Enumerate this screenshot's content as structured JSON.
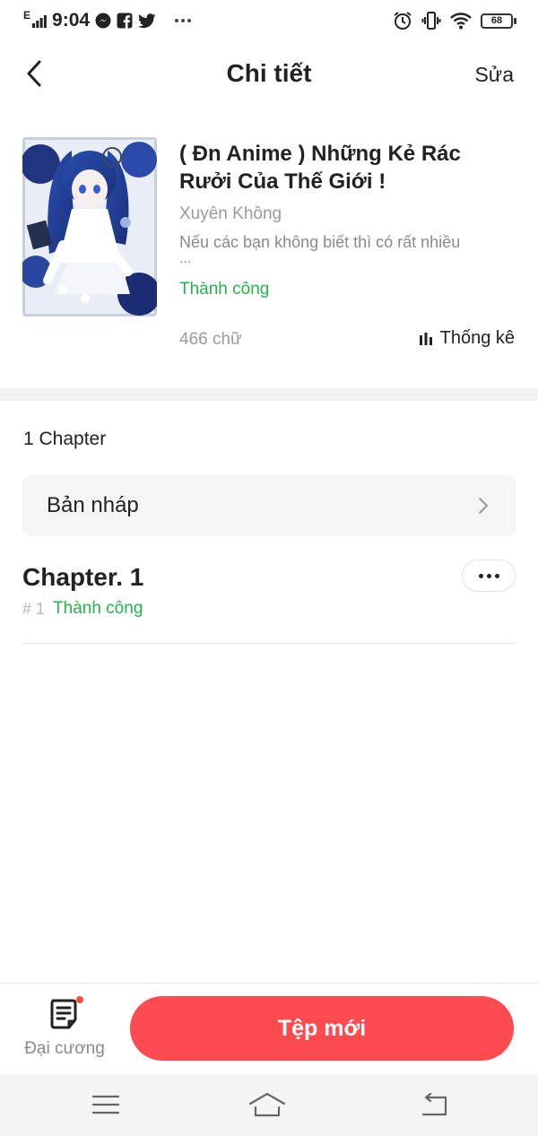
{
  "status_bar": {
    "network": "E",
    "time": "9:04",
    "battery_level": "68",
    "left_icons": [
      "signal-icon",
      "messenger-icon",
      "facebook-icon",
      "twitter-icon",
      "more-dots-icon"
    ],
    "right_icons": [
      "alarm-icon",
      "vibrate-icon",
      "wifi-icon",
      "battery-icon"
    ]
  },
  "header": {
    "title": "Chi tiết",
    "edit_label": "Sửa",
    "back_icon": "back-chevron-icon"
  },
  "story": {
    "title": "( Đn Anime ) Những Kẻ Rác Rưởi Của Thế Giới !",
    "genre": "Xuyên Không",
    "description": "Nếu các bạn không biết thì có rất nhiều",
    "description_ellipsis": "...",
    "status": "Thành công",
    "word_count": "466 chữ",
    "stats_label": "Thống kê",
    "stats_icon": "bar-chart-icon",
    "colors": {
      "status": "#27b24a",
      "muted": "#9a9a9a"
    }
  },
  "chapters": {
    "count_label": "1 Chapter",
    "draft_label": "Bản nháp",
    "items": [
      {
        "title": "Chapter. 1",
        "number": "# 1",
        "status": "Thành công"
      }
    ]
  },
  "bottom_bar": {
    "outline_label": "Đại cương",
    "new_file_label": "Tệp mới",
    "colors": {
      "accent": "#ff4a4f"
    }
  },
  "system_nav": {
    "icons": [
      "menu-icon",
      "home-icon",
      "back-icon"
    ]
  }
}
